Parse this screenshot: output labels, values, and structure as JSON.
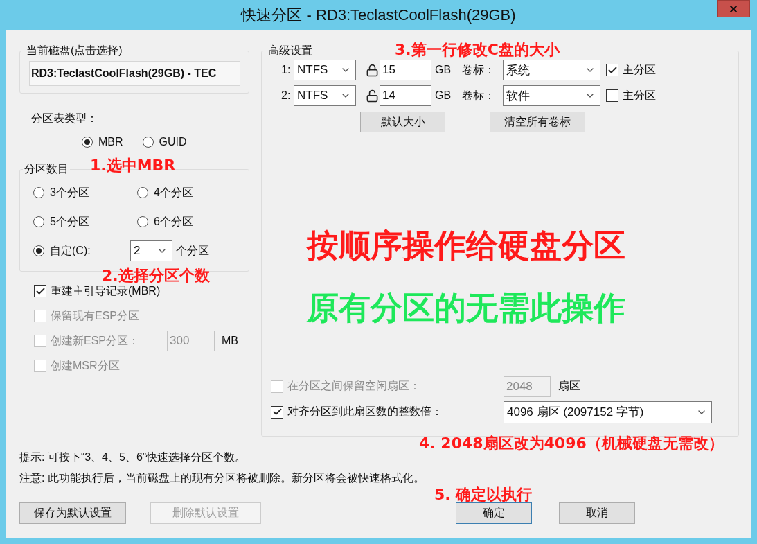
{
  "window": {
    "title": "快速分区 - RD3:TeclastCoolFlash(29GB)"
  },
  "disk_group": {
    "legend": "当前磁盘(点击选择)",
    "value": "RD3:TeclastCoolFlash(29GB) - TEC"
  },
  "partition_table": {
    "label": "分区表类型：",
    "options": [
      {
        "label": "MBR",
        "selected": true
      },
      {
        "label": "GUID",
        "selected": false
      }
    ]
  },
  "partition_count": {
    "legend": "分区数目",
    "options": [
      {
        "label": "3个分区",
        "selected": false,
        "kind": "preset"
      },
      {
        "label": "4个分区",
        "selected": false,
        "kind": "preset"
      },
      {
        "label": "5个分区",
        "selected": false,
        "kind": "preset"
      },
      {
        "label": "6个分区",
        "selected": false,
        "kind": "preset"
      },
      {
        "label": "自定(C):",
        "selected": true,
        "kind": "custom",
        "value": "2",
        "unit": "个分区"
      }
    ]
  },
  "options": [
    {
      "kind": "plain",
      "label": "重建主引导记录(MBR)",
      "checked": true,
      "disabled": false
    },
    {
      "kind": "plain",
      "label": "保留现有ESP分区",
      "checked": false,
      "disabled": true
    },
    {
      "kind": "size",
      "label": "创建新ESP分区：",
      "checked": false,
      "disabled": true,
      "value": "300",
      "unit": "MB"
    },
    {
      "kind": "plain",
      "label": "创建MSR分区",
      "checked": false,
      "disabled": true
    }
  ],
  "advanced": {
    "legend": "高级设置",
    "partitions": [
      {
        "index": "1:",
        "fs": "NTFS",
        "locked": true,
        "size": "15",
        "unit": "GB",
        "volume_label": "卷标：",
        "volume": "系统",
        "primary_label": "主分区",
        "primary": true
      },
      {
        "index": "2:",
        "fs": "NTFS",
        "locked": false,
        "size": "14",
        "unit": "GB",
        "volume_label": "卷标：",
        "volume": "软件",
        "primary_label": "主分区",
        "primary": false
      }
    ],
    "buttons": [
      {
        "label": "默认大小"
      },
      {
        "label": "清空所有卷标"
      }
    ],
    "alignment": [
      {
        "kind": "field",
        "label": "在分区之间保留空闲扇区：",
        "checked": false,
        "disabled": true,
        "value": "2048",
        "unit": "扇区"
      },
      {
        "kind": "select",
        "label": "对齐分区到此扇区数的整数倍：",
        "checked": true,
        "disabled": false,
        "value": "4096 扇区 (2097152 字节)"
      }
    ]
  },
  "notes": [
    "提示: 可按下“3、4、5、6”快速选择分区个数。",
    "注意: 此功能执行后，当前磁盘上的现有分区将被删除。新分区将会被快速格式化。"
  ],
  "left_buttons": [
    {
      "label": "保存为默认设置",
      "disabled": false,
      "focused": false
    },
    {
      "label": "删除默认设置",
      "disabled": true,
      "focused": false
    }
  ],
  "right_buttons": [
    {
      "label": "确定",
      "disabled": false,
      "focused": true
    },
    {
      "label": "取消",
      "disabled": false,
      "focused": false
    }
  ],
  "annotations": [
    {
      "text": "1.选中MBR",
      "color": "#ff1a1a",
      "kind": "step"
    },
    {
      "text": "2.选择分区个数",
      "color": "#ff1a1a",
      "kind": "step"
    },
    {
      "text": "3.第一行修改C盘的大小",
      "color": "#ff1a1a",
      "kind": "step"
    },
    {
      "text": "按顺序操作给硬盘分区",
      "color": "#ff1a1a",
      "kind": "headline"
    },
    {
      "text": "原有分区的无需此操作",
      "color": "#1ee85a",
      "kind": "headline"
    },
    {
      "text": "4. 2048扇区改为4096（机械硬盘无需改）",
      "color": "#ff1a1a",
      "kind": "step"
    },
    {
      "text": "5. 确定以执行",
      "color": "#ff1a1a",
      "kind": "step"
    }
  ]
}
